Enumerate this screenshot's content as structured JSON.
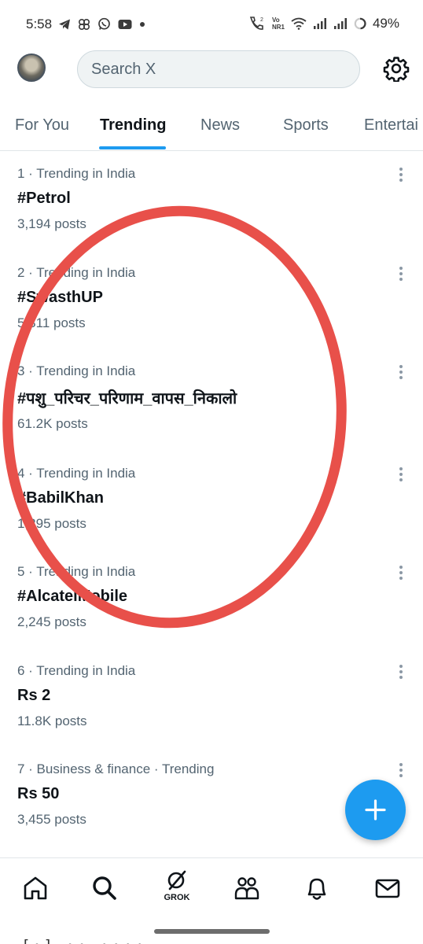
{
  "status_bar": {
    "time": "5:58",
    "left_icons": [
      "telegram-icon",
      "pinwheel-icon",
      "whatsapp-icon",
      "youtube-icon",
      "dot-icon"
    ],
    "network_label": "Vo NR1",
    "battery": "49%"
  },
  "header": {
    "search_placeholder": "Search X"
  },
  "tabs": [
    {
      "label": "For You"
    },
    {
      "label": "Trending"
    },
    {
      "label": "News"
    },
    {
      "label": "Sports"
    },
    {
      "label": "Entertai"
    }
  ],
  "active_tab": "Trending",
  "trends": [
    {
      "meta": "1 · Trending in India",
      "name": "#Petrol",
      "posts": "3,194 posts"
    },
    {
      "meta": "2 · Trending in India",
      "name": "#SwasthUP",
      "posts": "5,311 posts"
    },
    {
      "meta": "3 · Trending in India",
      "name": "#पशु_परिचर_परिणाम_वापस_निकालो",
      "posts": "61.2K posts"
    },
    {
      "meta": "4 · Trending in India",
      "name": "#BabilKhan",
      "posts": "1,295 posts"
    },
    {
      "meta": "5 · Trending in India",
      "name": "#AlcatelMobile",
      "posts": "2,245 posts"
    },
    {
      "meta": "6 · Trending in India",
      "name": "Rs 2",
      "posts": "11.8K posts"
    },
    {
      "meta": "7 · Business & finance · Trending",
      "name": "Rs 50",
      "posts": "3,455 posts"
    }
  ],
  "bottom_nav": [
    {
      "icon": "home-icon"
    },
    {
      "icon": "search-icon"
    },
    {
      "icon": "grok-icon",
      "label": "GROK"
    },
    {
      "icon": "communities-icon"
    },
    {
      "icon": "notifications-icon"
    },
    {
      "icon": "messages-icon"
    }
  ],
  "bottom_cutoff_text": "[•] •• ••••",
  "colors": {
    "accent": "#1d9bf0",
    "annotation": "#e8504a",
    "text_primary": "#0f1419",
    "text_secondary": "#536471"
  }
}
